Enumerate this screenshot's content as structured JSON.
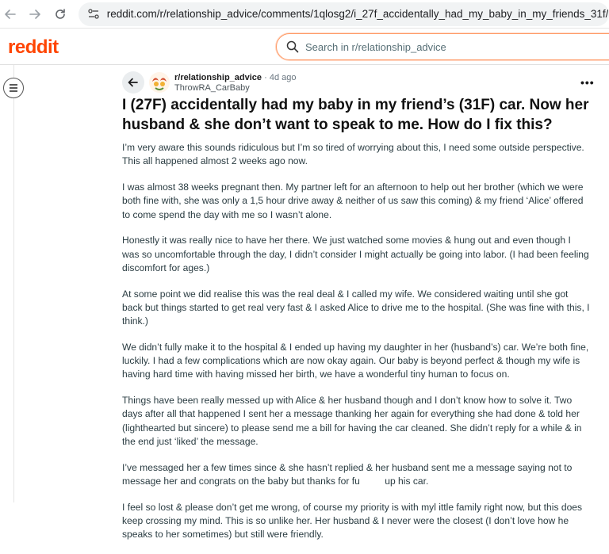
{
  "browser": {
    "url": "reddit.com/r/relationship_advice/comments/1qlosg2/i_27f_accidentally_had_my_baby_in_my_friends_31f/"
  },
  "header": {
    "logo_text": "reddit",
    "search_placeholder": "Search in r/relationship_advice"
  },
  "post": {
    "subreddit": "r/relationship_advice",
    "age": "· 4d ago",
    "author": "ThrowRA_CarBaby",
    "title": "I (27F) accidentally had my baby in my friend’s (31F) car. Now her husband & she don’t want to speak to me. How do I fix this?",
    "paragraphs": [
      "I’m very aware this sounds ridiculous but I’m so tired of worrying about this, I need some outside perspective. This all happened almost 2 weeks ago now.",
      "I was almost 38 weeks pregnant then. My partner left for an afternoon to help out her brother (which we were both fine with, she was only a 1,5 hour drive away & neither of us saw this coming) & my friend ‘Alice’ offered to come spend the day with me so I wasn’t alone.",
      "Honestly it was really nice to have her there. We just watched some movies & hung out and even though I was so uncomfortable through the day, I didn’t consider I might actually be going into labor. (I had been feeling discomfort for ages.)",
      "At some point we did realise this was the real deal & I called my wife. We considered waiting until she got back but things started to get real very fast & I asked Alice to drive me to the hospital. (She was fine with this, I think.)",
      "We didn’t fully make it to the hospital & I ended up having my daughter in her (husband’s) car. We’re both fine, luckily. I had a few complications which are now okay again. Our baby is beyond perfect & though my wife is having hard time with having missed her birth, we have a wonderful tiny human to focus on.",
      "Things have been really messed up with Alice & her husband though and I don’t know how to solve it. Two days after all that happened I sent her a message thanking her again for everything she had done & told her (lighthearted but sincere) to please send me a bill for having the car cleaned. She didn’t reply for a while & in the end just ‘liked’ the message."
    ],
    "para7_before": "I’ve messaged her a few times since & she hasn’t replied & her husband sent me a message saying not to message her and congrats on the baby but thanks for fu",
    "para7_after": " up his car.",
    "para8": "I feel so lost & please don’t get me wrong, of course my priority is with myl ittle family right now, but this does keep crossing my mind. This is so unlike her. Her husband & I never were the closest (I don’t love how he speaks to her sometimes) but still were friendly."
  }
}
